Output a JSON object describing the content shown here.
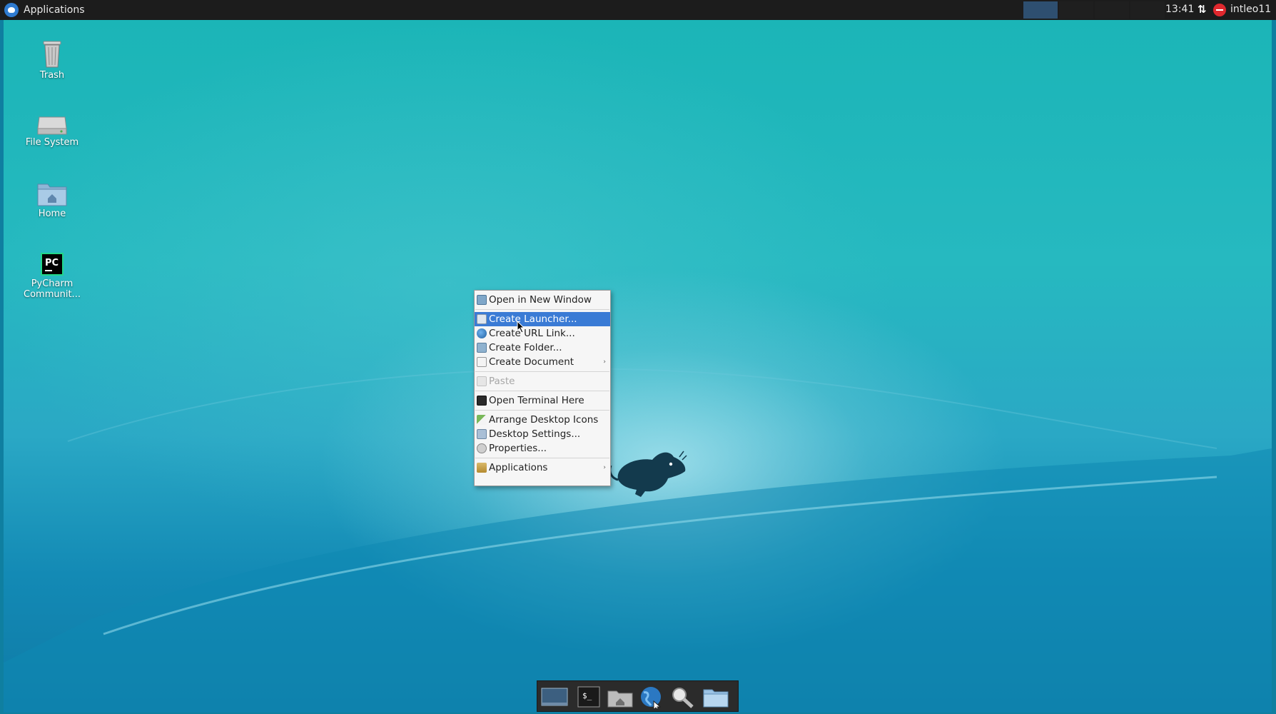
{
  "top_panel": {
    "apps_label": "Applications",
    "clock": "13:41",
    "user": "intleo11",
    "icons": [
      "xfce-logo-icon",
      "network-icon",
      "do-not-disturb-icon"
    ]
  },
  "desktop_icons": [
    {
      "label": "Trash",
      "icon": "trash-icon"
    },
    {
      "label": "File System",
      "icon": "drive-icon"
    },
    {
      "label": "Home",
      "icon": "home-folder-icon"
    },
    {
      "label": "PyCharm Communit...",
      "icon": "pycharm-icon"
    }
  ],
  "context_menu": {
    "items": [
      {
        "label": "Open in New Window",
        "icon": "window-icon"
      },
      {
        "label": "Create Launcher...",
        "icon": "launcher-icon",
        "highlighted": true
      },
      {
        "label": "Create URL Link...",
        "icon": "globe-icon"
      },
      {
        "label": "Create Folder...",
        "icon": "folder-new-icon"
      },
      {
        "label": "Create Document",
        "icon": "document-new-icon",
        "submenu": true
      },
      {
        "label": "Paste",
        "icon": "paste-icon",
        "disabled": true
      },
      {
        "label": "Open Terminal Here",
        "icon": "terminal-icon"
      },
      {
        "label": "Arrange Desktop Icons",
        "icon": "arrange-icon"
      },
      {
        "label": "Desktop Settings...",
        "icon": "settings-icon"
      },
      {
        "label": "Properties...",
        "icon": "properties-icon"
      },
      {
        "label": "Applications",
        "icon": "applications-icon",
        "submenu": true
      }
    ],
    "submenu_arrow": "›"
  },
  "dock": {
    "items": [
      "show-desktop-icon",
      "terminal-icon",
      "home-folder-icon",
      "web-browser-icon",
      "search-icon",
      "folder-icon"
    ],
    "terminal_glyph": "$_"
  },
  "colors": {
    "panel": "#1c1c1c",
    "menu_highlight": "#3a7bd5",
    "workspace_active": "#2e4f70"
  }
}
